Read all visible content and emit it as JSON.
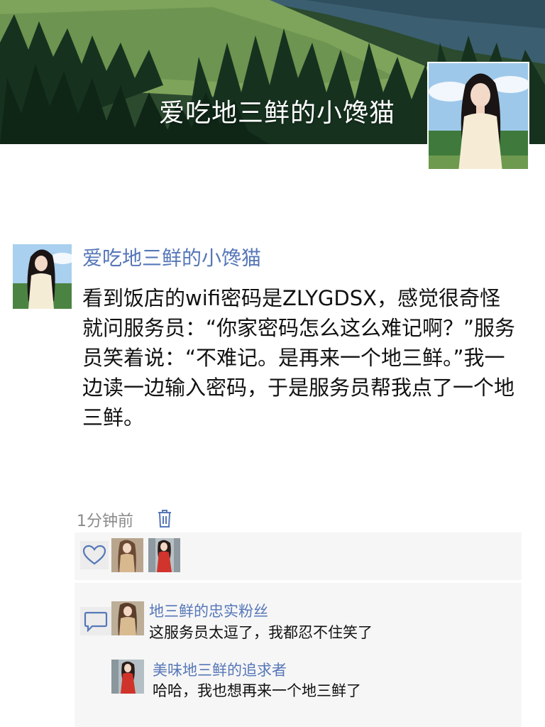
{
  "cover": {
    "title": "爱吃地三鲜的小馋猫"
  },
  "post": {
    "author": "爱吃地三鲜的小馋猫",
    "text": "看到饭店的wifi密码是ZLYGDSX，感觉很奇怪就问服务员：“你家密码怎么这么难记啊？”服务员笑着说：“不难记。是再来一个地三鲜。”我一边读一边输入密码，于是服务员帮我点了一个地三鲜。",
    "time": "1分钟前"
  },
  "likes": {
    "icon": "heart-icon",
    "count": 2
  },
  "comments": [
    {
      "author": "地三鲜的忠实粉丝",
      "text": "这服务员太逗了，我都忍不住笑了"
    },
    {
      "author": "美味地三鲜的追求者",
      "text": "哈哈，我也想再来一个地三鲜了"
    }
  ],
  "colors": {
    "accent": "#5677b8",
    "panel": "#f6f6f6",
    "meta": "#8a8a8a"
  }
}
